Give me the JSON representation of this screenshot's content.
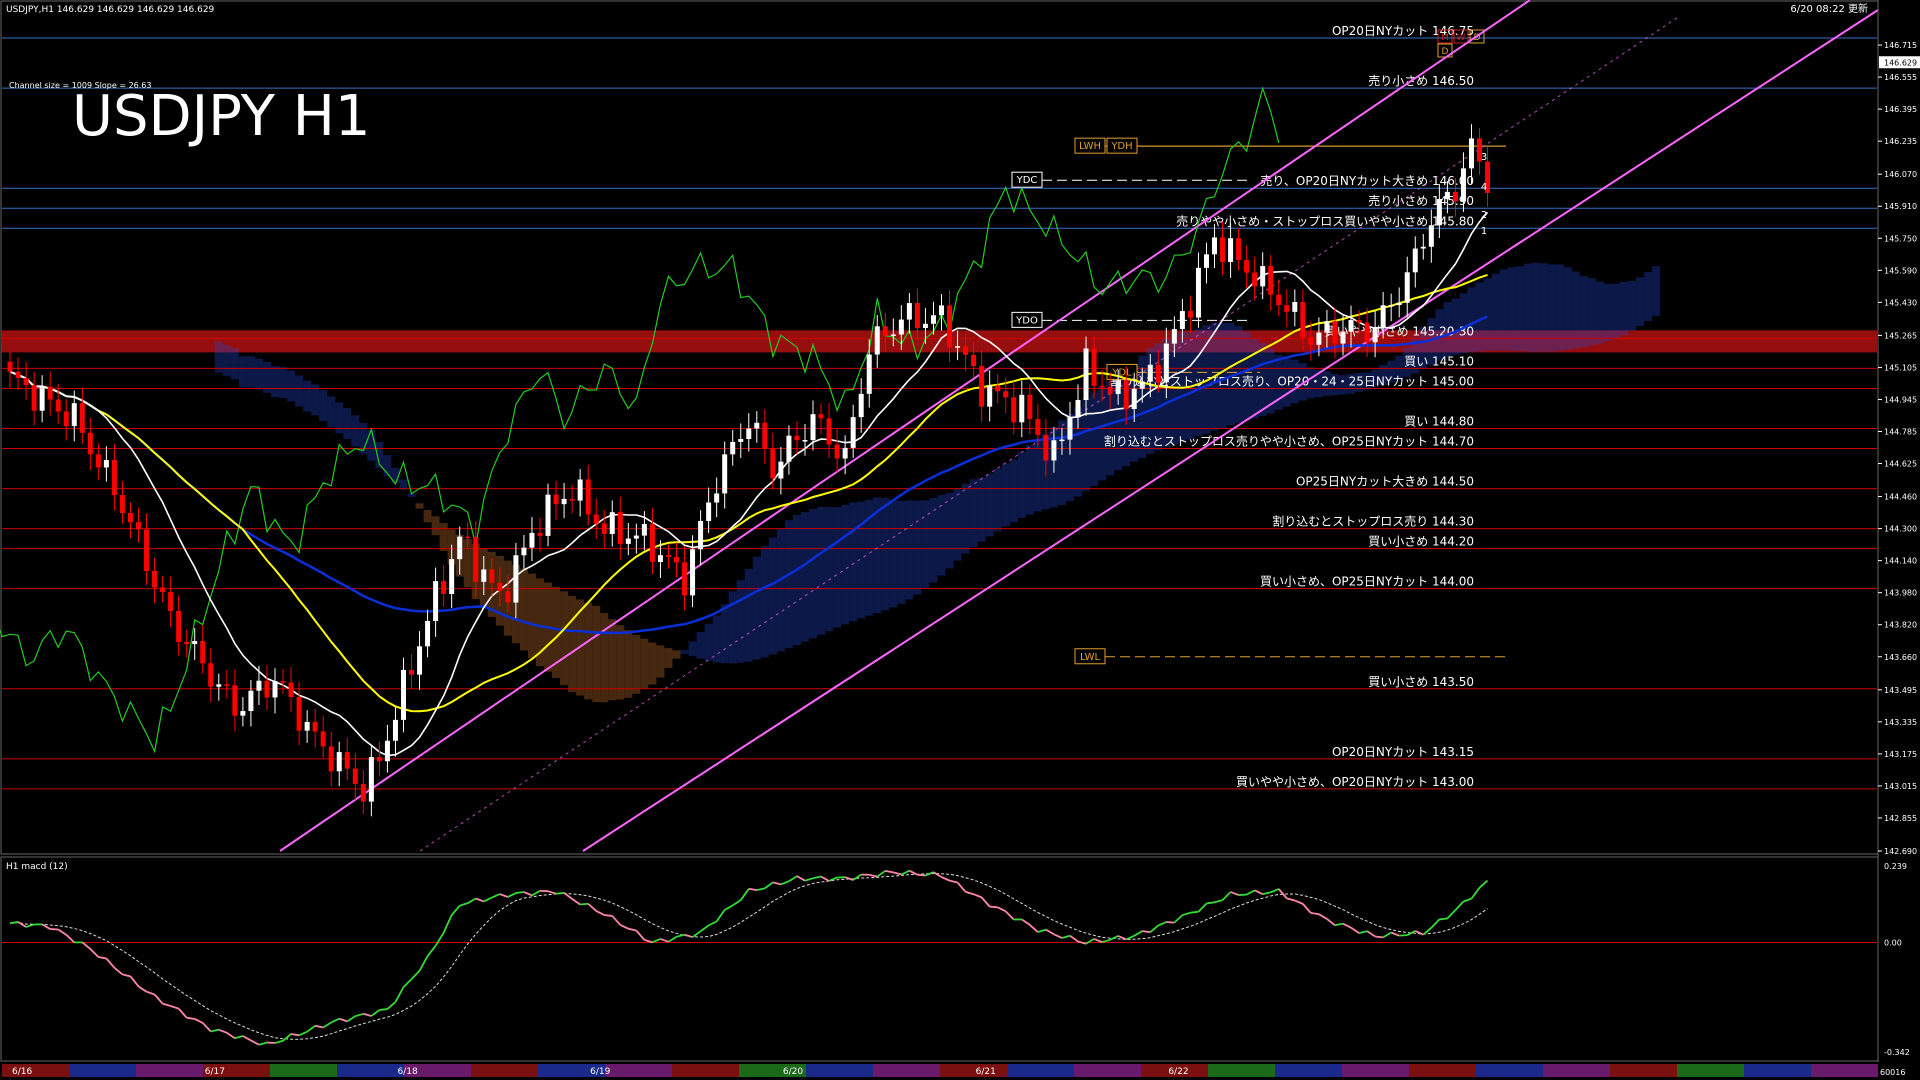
{
  "header": {
    "symbol_info": "USDJPY,H1  146.629 146.629 146.629 146.629",
    "updated": "6/20 08:22 更新",
    "channel_info": "Channel size = 1009 Slope = 26.63",
    "big_title": "USDJPY H1"
  },
  "indicator": {
    "title": "H1  macd (12)",
    "scale": [
      "0.239",
      "0.00",
      "-0.342"
    ]
  },
  "bottom_corner": "60016",
  "markers": {
    "yd_labels": [
      "YDC",
      "YDO",
      "YDL",
      "LWH",
      "YDH",
      "LWL"
    ],
    "corner_boxes": [
      "M",
      "W",
      "D",
      "D"
    ],
    "wave_counts": [
      "3",
      "4",
      "2",
      "1"
    ]
  },
  "colors": {
    "bg": "#000000",
    "bull": "#ffffff",
    "bear": "#ff0000",
    "hline_red": "#cc0000",
    "hline_blue": "#3a6fc4",
    "channel": "#ff66ff",
    "ma_white": "#ffffff",
    "ma_yellow": "#ffff00",
    "ma_blue": "#0a2fd8",
    "lagging": "#22cc22",
    "macd_main": "#33dd33",
    "macd_neg": "#ff88aa",
    "zone": "#b01010"
  },
  "chart_data": {
    "type": "candlestick",
    "title": "USDJPY H1",
    "ylim": [
      142.69,
      146.86
    ],
    "price_ticks": [
      "146.715",
      "146.555",
      "146.395",
      "146.235",
      "146.070",
      "145.910",
      "145.750",
      "145.590",
      "145.430",
      "145.265",
      "145.105",
      "144.945",
      "144.785",
      "144.625",
      "144.460",
      "144.300",
      "144.140",
      "143.980",
      "143.820",
      "143.660",
      "143.495",
      "143.335",
      "143.175",
      "143.015",
      "142.855",
      "142.690"
    ],
    "current_price": "146.629",
    "levels": [
      {
        "price": 146.75,
        "label": "OP20日NYカット 146.75",
        "color": "blue"
      },
      {
        "price": 146.5,
        "label": "売り小さめ 146.50",
        "color": "blue"
      },
      {
        "price": 146.0,
        "label": "売り、OP20日NYカット大きめ 146.00",
        "color": "blue"
      },
      {
        "price": 145.9,
        "label": "売り小さめ 145.90",
        "color": "blue"
      },
      {
        "price": 145.8,
        "label": "売りやや小さめ・ストップロス買いやや小さめ 145.80",
        "color": "blue"
      },
      {
        "price": 145.25,
        "label": "買いやや小さめ 145.20-30",
        "color": "red"
      },
      {
        "price": 145.1,
        "label": "買い 145.10",
        "color": "red"
      },
      {
        "price": 145.0,
        "label": "割り込むとストップロス売り、OP20・24・25日NYカット 145.00",
        "color": "red"
      },
      {
        "price": 144.8,
        "label": "買い 144.80",
        "color": "red"
      },
      {
        "price": 144.7,
        "label": "割り込むとストップロス売りやや小さめ、OP25日NYカット 144.70",
        "color": "red"
      },
      {
        "price": 144.5,
        "label": "OP25日NYカット大きめ 144.50",
        "color": "red"
      },
      {
        "price": 144.3,
        "label": "割り込むとストップロス売り 144.30",
        "color": "red"
      },
      {
        "price": 144.2,
        "label": "買い小さめ 144.20",
        "color": "red"
      },
      {
        "price": 144.0,
        "label": "買い小さめ、OP25日NYカット 144.00",
        "color": "red"
      },
      {
        "price": 143.5,
        "label": "買い小さめ 143.50",
        "color": "red"
      },
      {
        "price": 143.15,
        "label": "OP20日NYカット 143.15",
        "color": "red"
      },
      {
        "price": 143.0,
        "label": "買いやや小さめ、OP20日NYカット 143.00",
        "color": "red"
      }
    ],
    "zone": [
      145.18,
      145.29
    ],
    "yd_levels": {
      "YDC": 146.04,
      "YDO": 145.34,
      "YDL": 145.08,
      "LWH": 146.21,
      "YDH": 146.21,
      "LWL": 143.66
    },
    "dates": [
      "6/16",
      "6/17",
      "6/18",
      "6/19",
      "6/20",
      "6/21",
      "6/22"
    ],
    "bar_start_index": [
      0,
      24,
      48,
      72,
      96,
      120,
      144
    ],
    "anchors": [
      [
        0,
        145.05
      ],
      [
        8,
        144.85
      ],
      [
        14,
        144.42
      ],
      [
        20,
        143.85
      ],
      [
        28,
        143.4
      ],
      [
        33,
        143.55
      ],
      [
        38,
        143.25
      ],
      [
        44,
        143.0
      ],
      [
        46,
        143.15
      ],
      [
        52,
        143.85
      ],
      [
        56,
        144.25
      ],
      [
        61,
        143.95
      ],
      [
        66,
        144.35
      ],
      [
        70,
        144.5
      ],
      [
        74,
        144.3
      ],
      [
        79,
        144.25
      ],
      [
        84,
        144.05
      ],
      [
        88,
        144.55
      ],
      [
        92,
        144.85
      ],
      [
        95,
        144.6
      ],
      [
        100,
        144.85
      ],
      [
        104,
        144.65
      ],
      [
        107,
        145.2
      ],
      [
        111,
        145.35
      ],
      [
        116,
        145.35
      ],
      [
        121,
        145.0
      ],
      [
        126,
        144.9
      ],
      [
        130,
        144.65
      ],
      [
        134,
        145.1
      ],
      [
        138,
        144.95
      ],
      [
        142,
        145.05
      ],
      [
        146,
        145.35
      ],
      [
        150,
        145.75
      ],
      [
        154,
        145.6
      ],
      [
        158,
        145.45
      ],
      [
        162,
        145.25
      ],
      [
        166,
        145.3
      ],
      [
        170,
        145.3
      ],
      [
        174,
        145.55
      ],
      [
        177,
        145.85
      ],
      [
        180,
        146.0
      ],
      [
        182,
        146.2
      ],
      [
        184,
        146.05
      ]
    ],
    "macd_anchors": [
      [
        0,
        0.06
      ],
      [
        5,
        0.05
      ],
      [
        10,
        -0.02
      ],
      [
        18,
        -0.17
      ],
      [
        25,
        -0.27
      ],
      [
        32,
        -0.32
      ],
      [
        40,
        -0.25
      ],
      [
        47,
        -0.21
      ],
      [
        52,
        -0.05
      ],
      [
        56,
        0.12
      ],
      [
        62,
        0.15
      ],
      [
        68,
        0.16
      ],
      [
        74,
        0.09
      ],
      [
        80,
        0.0
      ],
      [
        86,
        0.03
      ],
      [
        92,
        0.16
      ],
      [
        98,
        0.2
      ],
      [
        104,
        0.2
      ],
      [
        110,
        0.22
      ],
      [
        116,
        0.21
      ],
      [
        122,
        0.12
      ],
      [
        128,
        0.04
      ],
      [
        134,
        0.0
      ],
      [
        140,
        0.02
      ],
      [
        146,
        0.08
      ],
      [
        152,
        0.15
      ],
      [
        158,
        0.16
      ],
      [
        164,
        0.07
      ],
      [
        170,
        0.02
      ],
      [
        176,
        0.03
      ],
      [
        180,
        0.1
      ],
      [
        184,
        0.19
      ]
    ]
  }
}
